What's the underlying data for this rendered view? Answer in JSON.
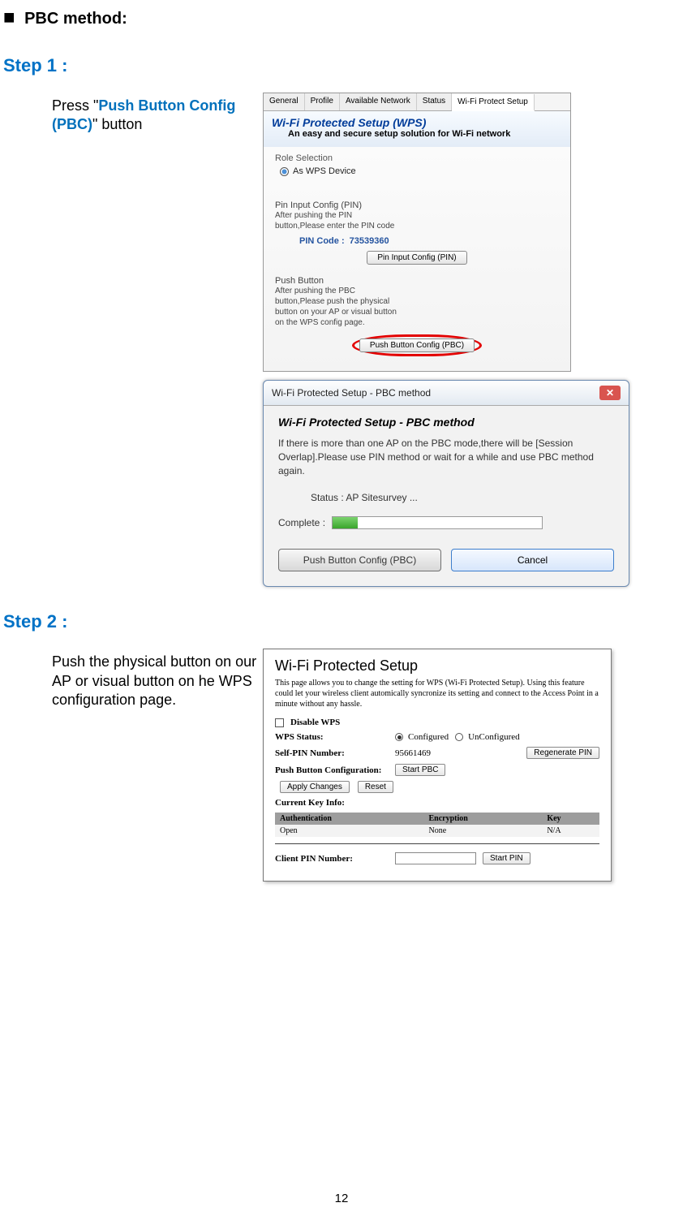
{
  "heading": "PBC method:",
  "step1": {
    "label": "Step 1 :",
    "text_prefix": "Press \"",
    "highlight": "Push Button Config (PBC)",
    "text_suffix": "\" button"
  },
  "panel1": {
    "tabs": [
      "General",
      "Profile",
      "Available Network",
      "Status",
      "Wi-Fi Protect Setup"
    ],
    "active_tab": 4,
    "title": "Wi-Fi Protected Setup (WPS)",
    "subtitle": "An easy and secure setup solution for Wi-Fi network",
    "role_label": "Role Selection",
    "role_option": "As WPS Device",
    "pin_group_label": "Pin Input Config (PIN)",
    "pin_desc_l1": "After pushing the PIN",
    "pin_desc_l2": "button,Please enter the PIN code",
    "pin_code_label": "PIN Code :",
    "pin_code_value": "73539360",
    "pin_button": "Pin Input Config (PIN)",
    "pbc_group_label": "Push Button",
    "pbc_desc_l1": "After pushing the PBC",
    "pbc_desc_l2": "button,Please push the physical",
    "pbc_desc_l3": "button on your AP or visual button",
    "pbc_desc_l4": "on the WPS config page.",
    "pbc_button": "Push Button Config (PBC)"
  },
  "dialog": {
    "title": "Wi-Fi Protected Setup - PBC method",
    "heading": "Wi-Fi Protected Setup - PBC method",
    "info": "If there is more than one AP on the PBC mode,there will be [Session Overlap].Please use PIN method or wait for a while and use PBC method again.",
    "status_label": "Status :",
    "status_value": "AP Sitesurvey ...",
    "complete_label": "Complete :",
    "btn_pbc": "Push Button Config (PBC)",
    "btn_cancel": "Cancel"
  },
  "step2": {
    "label": "Step 2 :",
    "text": "Push the physical button on our AP or visual button on he WPS configuration page."
  },
  "panel3": {
    "title": "Wi-Fi Protected Setup",
    "desc": "This page allows you to change the setting for WPS (Wi-Fi Protected Setup). Using this feature could let your wireless client automically syncronize its setting and connect to the Access Point in a minute without any hassle.",
    "disable_wps": "Disable WPS",
    "wps_status_label": "WPS Status:",
    "configured": "Configured",
    "unconfigured": "UnConfigured",
    "selfpin_label": "Self-PIN Number:",
    "selfpin_value": "95661469",
    "regen_btn": "Regenerate PIN",
    "pbc_label": "Push Button Configuration:",
    "start_pbc_btn": "Start PBC",
    "apply_btn": "Apply Changes",
    "reset_btn": "Reset",
    "cki_label": "Current Key Info:",
    "th_auth": "Authentication",
    "th_enc": "Encryption",
    "th_key": "Key",
    "td_auth": "Open",
    "td_enc": "None",
    "td_key": "N/A",
    "clientpin_label": "Client PIN Number:",
    "startpin_btn": "Start PIN"
  },
  "page_num": "12"
}
